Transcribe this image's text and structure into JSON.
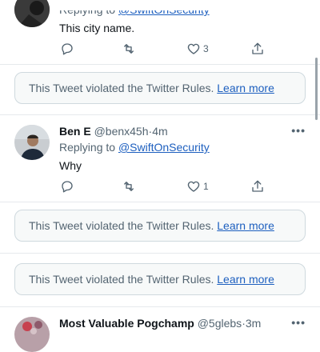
{
  "tweets": [
    {
      "replying_prefix": "Replying to",
      "replying_handle": "@SwiftOnSecurity",
      "text": "This city name.",
      "like_count": "3"
    },
    {
      "name": "Ben E",
      "handle": "@benx45h",
      "sep": "·",
      "time": "4m",
      "replying_prefix": "Replying to",
      "replying_handle": "@SwiftOnSecurity",
      "text": "Why",
      "like_count": "1"
    },
    {
      "name": "Most Valuable Pogchamp",
      "handle": "@5glebs",
      "sep": "·",
      "time": "3m"
    }
  ],
  "notices": [
    {
      "text": "This Tweet violated the Twitter Rules.",
      "link": "Learn more"
    },
    {
      "text": "This Tweet violated the Twitter Rules.",
      "link": "Learn more"
    },
    {
      "text": "This Tweet violated the Twitter Rules.",
      "link": "Learn more"
    }
  ],
  "more_symbol": "•••",
  "colors": {
    "link": "#1d5fbf",
    "muted": "#536471",
    "border": "#cfd9de"
  }
}
